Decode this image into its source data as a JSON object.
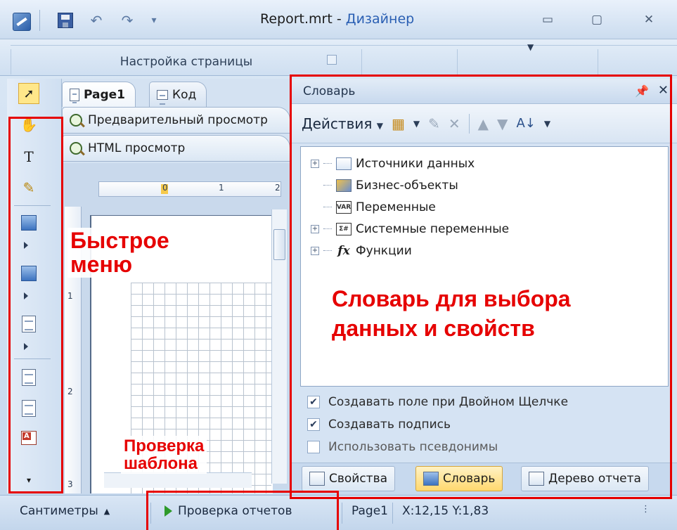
{
  "window": {
    "file": "Report.mrt",
    "separator": " - ",
    "app": "Дизайнер"
  },
  "ribbon": {
    "group_label": "Настройка страницы"
  },
  "document": {
    "tabs": [
      {
        "label": "Page1"
      },
      {
        "label": "Код"
      }
    ],
    "subtabs": [
      {
        "label": "Предварительный просмотр"
      },
      {
        "label": "HTML просмотр"
      }
    ],
    "ruler_h": [
      "0",
      "1",
      "2"
    ],
    "ruler_v": [
      "1",
      "2",
      "3"
    ]
  },
  "dictionary": {
    "title": "Словарь",
    "actions_label": "Действия",
    "tree": [
      {
        "label": "Источники данных",
        "icon": "database-icon",
        "expandable": true
      },
      {
        "label": "Бизнес-объекты",
        "icon": "business-objects-icon",
        "expandable": false
      },
      {
        "label": "Переменные",
        "icon": "variables-icon",
        "icon_text": "VAR",
        "expandable": false
      },
      {
        "label": "Системные переменные",
        "icon": "system-variables-icon",
        "icon_text": "Σ#",
        "expandable": true
      },
      {
        "label": "Функции",
        "icon": "functions-icon",
        "icon_text": "fx",
        "expandable": true
      }
    ],
    "options": [
      {
        "label": "Создавать поле при Двойном Щелчке",
        "checked": true
      },
      {
        "label": "Создавать подпись",
        "checked": true
      },
      {
        "label": "Использовать псевдонимы",
        "checked": false
      }
    ],
    "bottom_tabs": [
      {
        "label": "Свойства"
      },
      {
        "label": "Словарь"
      },
      {
        "label": "Дерево отчета"
      }
    ]
  },
  "statusbar": {
    "units": "Сантиметры",
    "check_reports": "Проверка отчетов",
    "page": "Page1",
    "coords": "X:12,15  Y:1,83"
  },
  "annotations": {
    "quick_menu_1": "Быстрое",
    "quick_menu_2": "меню",
    "template_check_1": "Проверка",
    "template_check_2": "шаблона",
    "dict_1": "Словарь для выбора",
    "dict_2": "данных и свойств",
    "color": "#e60000"
  }
}
